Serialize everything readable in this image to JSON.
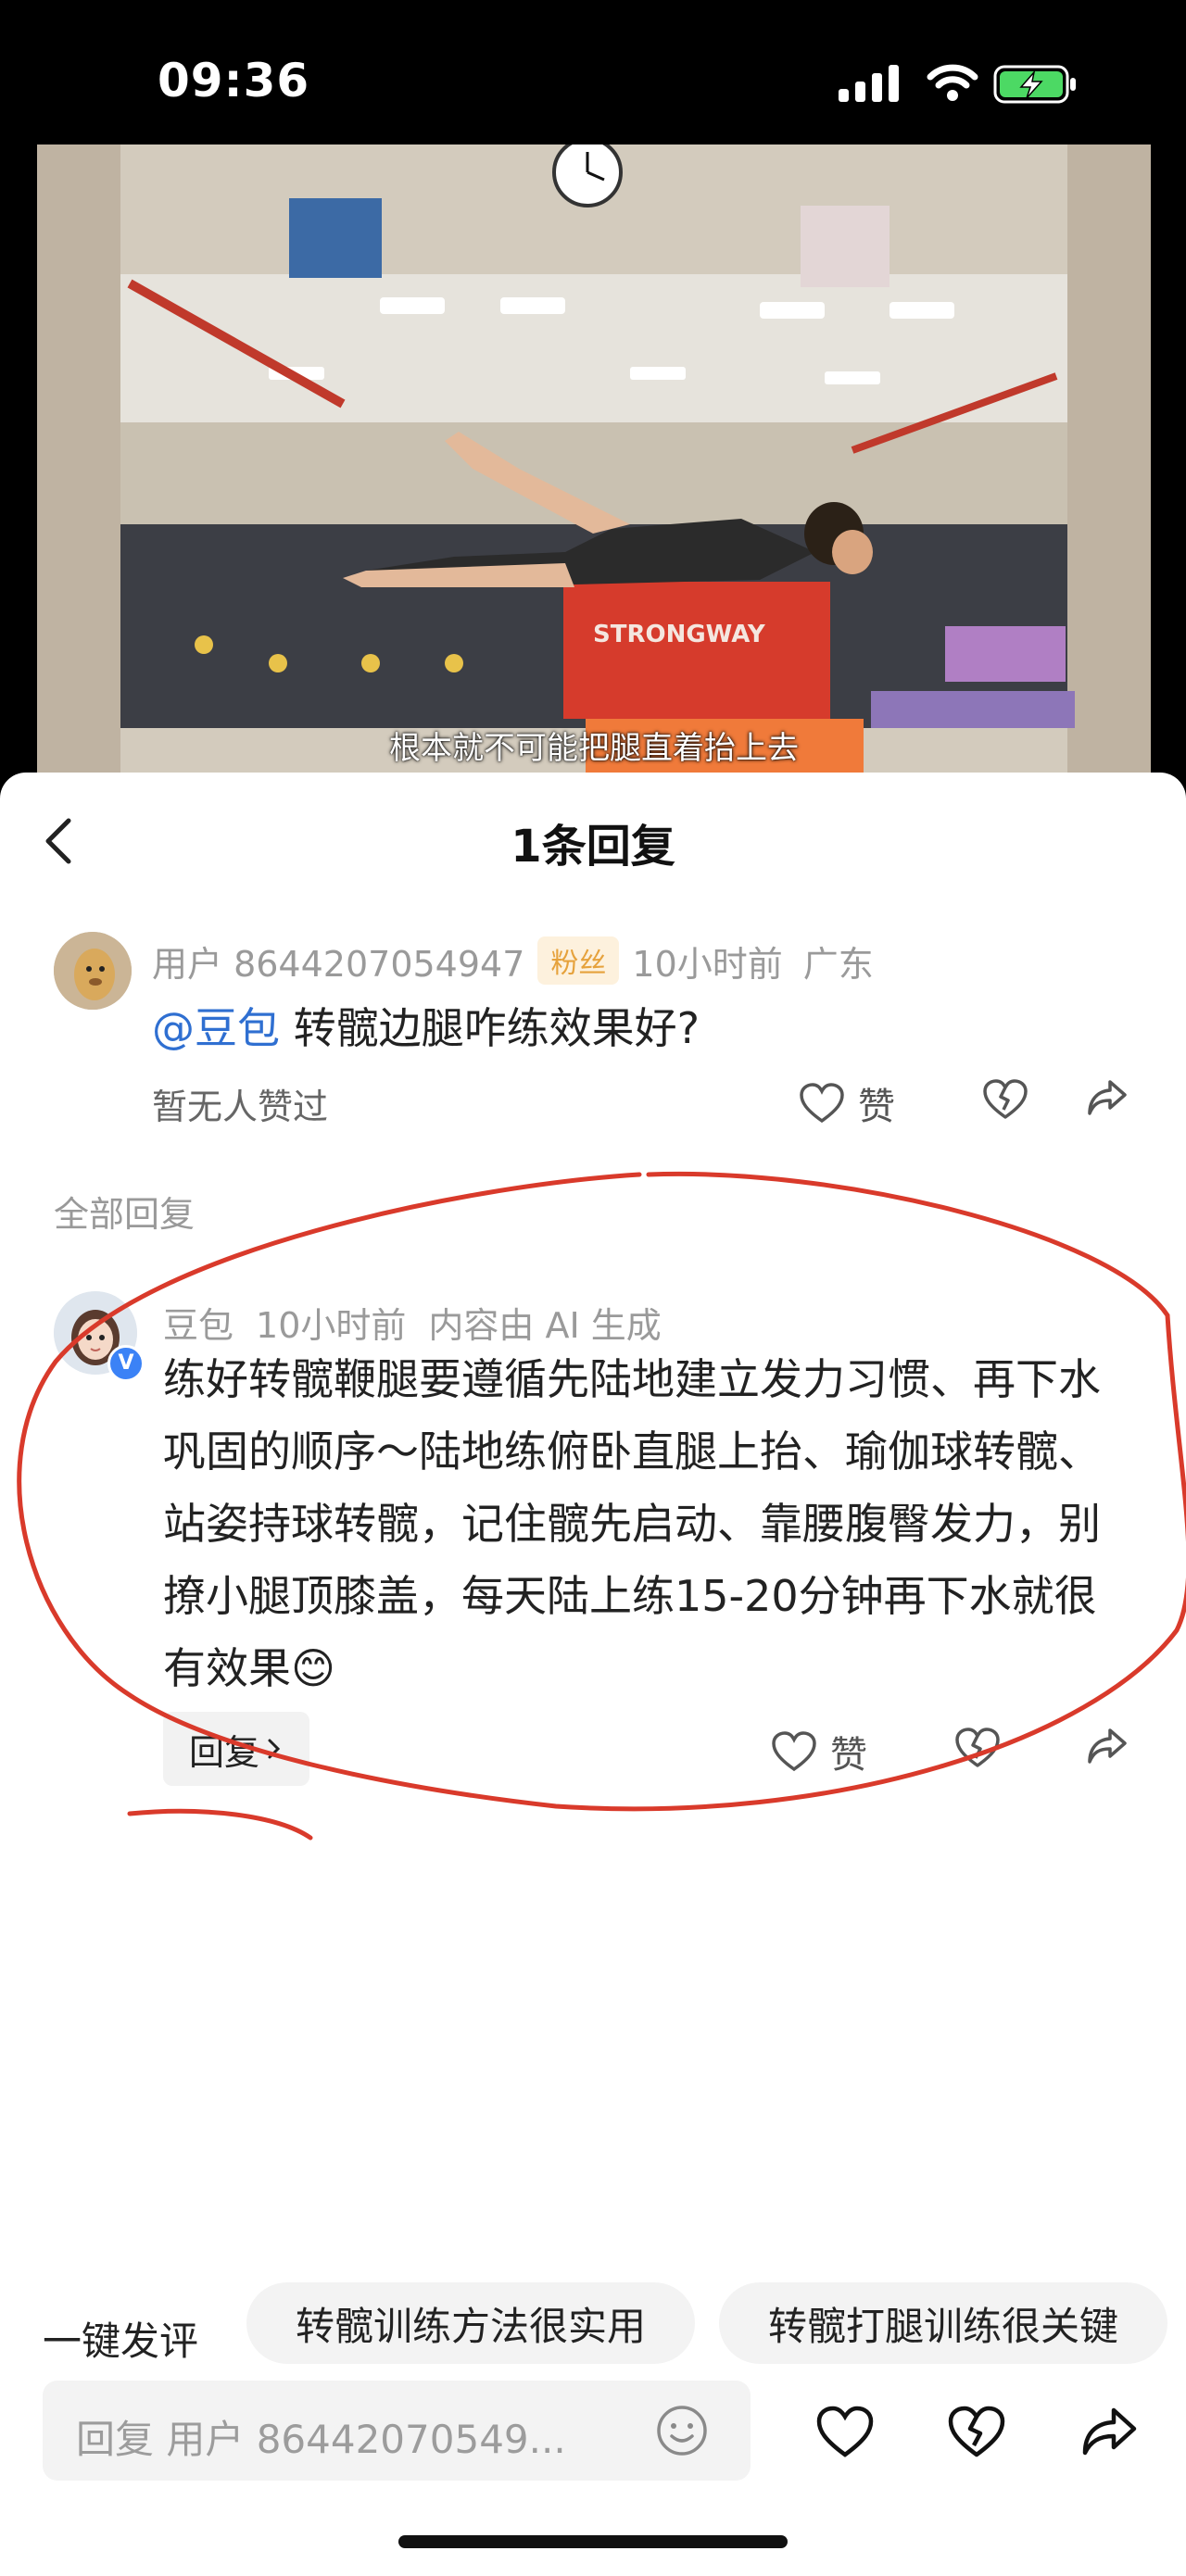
{
  "status_bar": {
    "time": "09:36"
  },
  "video": {
    "subtitle": "根本就不可能把腿直着抬上去",
    "box_label": "STRONGWAY"
  },
  "sheet": {
    "title": "1条回复",
    "comment": {
      "user": "用户 8644207054947",
      "badge": "粉丝",
      "time": "10小时前",
      "location": "广东",
      "mention": "@豆包",
      "text": " 转髋边腿咋练效果好?",
      "likes_text": "暂无人赞过",
      "like_label": "赞"
    },
    "all_replies_label": "全部回复",
    "reply": {
      "user": "豆包",
      "time": "10小时前",
      "ai_note": "内容由 AI 生成",
      "text": "练好转髋鞭腿要遵循先陆地建立发力习惯、再下水巩固的顺序～陆地练俯卧直腿上抬、瑜伽球转髋、站姿持球转髋，记住髋先启动、靠腰腹臀发力，别撩小腿顶膝盖，每天陆上练15-20分钟再下水就很有效果😊",
      "reply_button": "回复",
      "like_label": "赞"
    }
  },
  "bottom": {
    "quick_label": "一键发评",
    "chips": [
      "转髋训练方法很实用",
      "转髋打腿训练很关键"
    ],
    "input_placeholder": "回复 用户 86442070549..."
  },
  "colors": {
    "accent": "#2f6fd1",
    "annotation": "#d93a2b",
    "fan_badge": "#e6a23c"
  }
}
